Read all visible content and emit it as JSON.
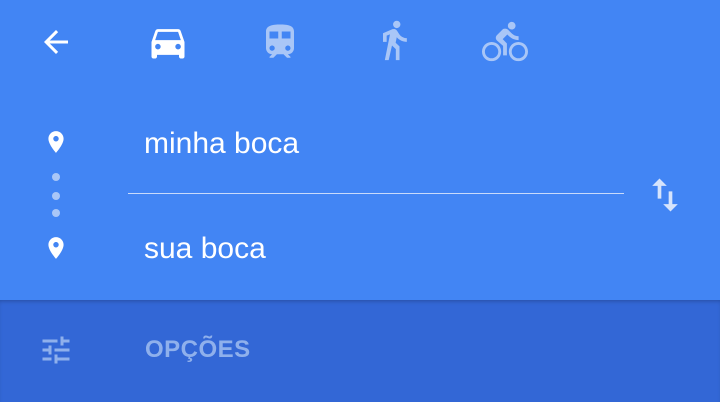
{
  "colors": {
    "primary": "#4285f4",
    "primary_dark": "#3367d6",
    "active_icon": "#ffffff",
    "inactive_icon": "#a9c6f7"
  },
  "header": {
    "back_icon": "arrow-back-icon",
    "travel_modes": [
      {
        "icon": "car-icon",
        "selected": true
      },
      {
        "icon": "train-icon",
        "selected": false
      },
      {
        "icon": "walk-icon",
        "selected": false
      },
      {
        "icon": "bike-icon",
        "selected": false
      }
    ]
  },
  "route": {
    "origin": "minha boca",
    "destination": "sua boca",
    "swap_icon": "swap-vertical-icon"
  },
  "options": {
    "icon": "tune-sliders-icon",
    "label": "OPÇÕES"
  }
}
